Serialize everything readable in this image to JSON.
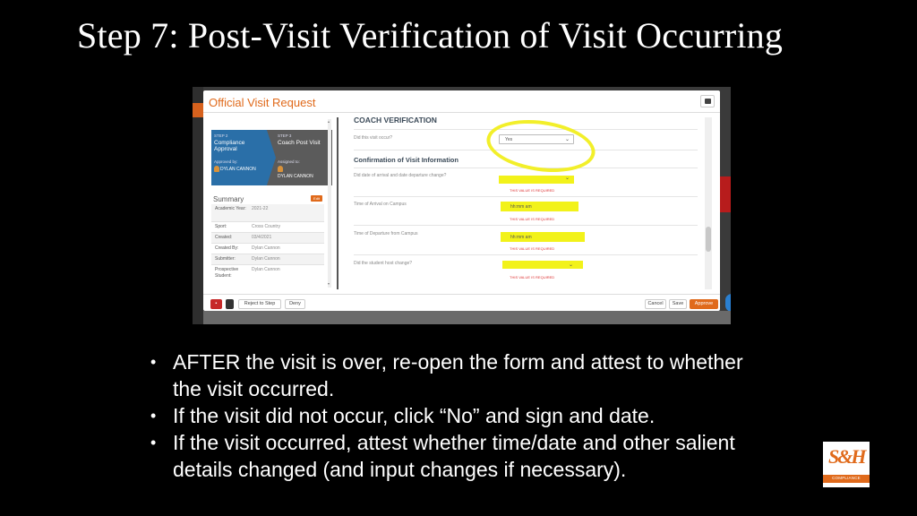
{
  "slide": {
    "title": "Step 7: Post-Visit Verification of  Visit Occurring",
    "bullets": [
      "AFTER the visit is over, re-open the form and attest to whether the visit occurred.",
      "If the visit did not occur, click “No” and sign and date.",
      "If the visit occurred, attest whether time/date and other salient details changed (and input changes if necessary)."
    ],
    "bullet_symbol": "•",
    "logo": {
      "mark": "S&H",
      "text": "COMPLIANCE",
      "color": "#e06a1b"
    },
    "annotation_color": "#f2ef2a"
  },
  "modal": {
    "title": "Official Visit Request",
    "print_icon": "print-icon",
    "steps": [
      {
        "number": "STEP 2",
        "name": "Compliance Approval",
        "role_label": "Approved by:",
        "person": "DYLAN CANNON"
      },
      {
        "number": "STEP 3",
        "name": "Coach Post Visit",
        "role_label": "Assigned to:",
        "person": "DYLAN CANNON"
      }
    ],
    "summary": {
      "title": "Summary",
      "edit_label": "Edit",
      "rows": [
        {
          "key": "Academic Year:",
          "value": "2021-22"
        },
        {
          "key": "Sport:",
          "value": "Cross Country"
        },
        {
          "key": "Created:",
          "value": "03/4/2021"
        },
        {
          "key": "Created By:",
          "value": "Dylan Cannon"
        },
        {
          "key": "Submitter:",
          "value": "Dylan Cannon"
        },
        {
          "key": "Prospective Student:",
          "value": "Dylan Cannon"
        }
      ]
    },
    "form": {
      "section1": "COACH VERIFICATION",
      "q1_label": "Did this visit occur?",
      "q1_value": "Yes",
      "section2": "Confirmation of Visit Information",
      "q2_label": "Did date of arrival and date departure change?",
      "q3_label": "Time of Arrival on Campus",
      "q3_value": "hh:mm am",
      "q4_label": "Time of Departure from Campus",
      "q4_value": "hh:mm am",
      "q5_label": "Did the student host change?",
      "required_text": "THIS VALUE IS REQUIRED"
    },
    "footer": {
      "reject_label": "Reject to Step",
      "deny_label": "Deny",
      "cancel_label": "Cancel",
      "save_label": "Save",
      "approve_label": "Approve"
    },
    "colors": {
      "accent": "#e06a1b",
      "step_blue": "#2a6fa8",
      "required": "#d33",
      "highlight": "#f2f21a"
    }
  }
}
